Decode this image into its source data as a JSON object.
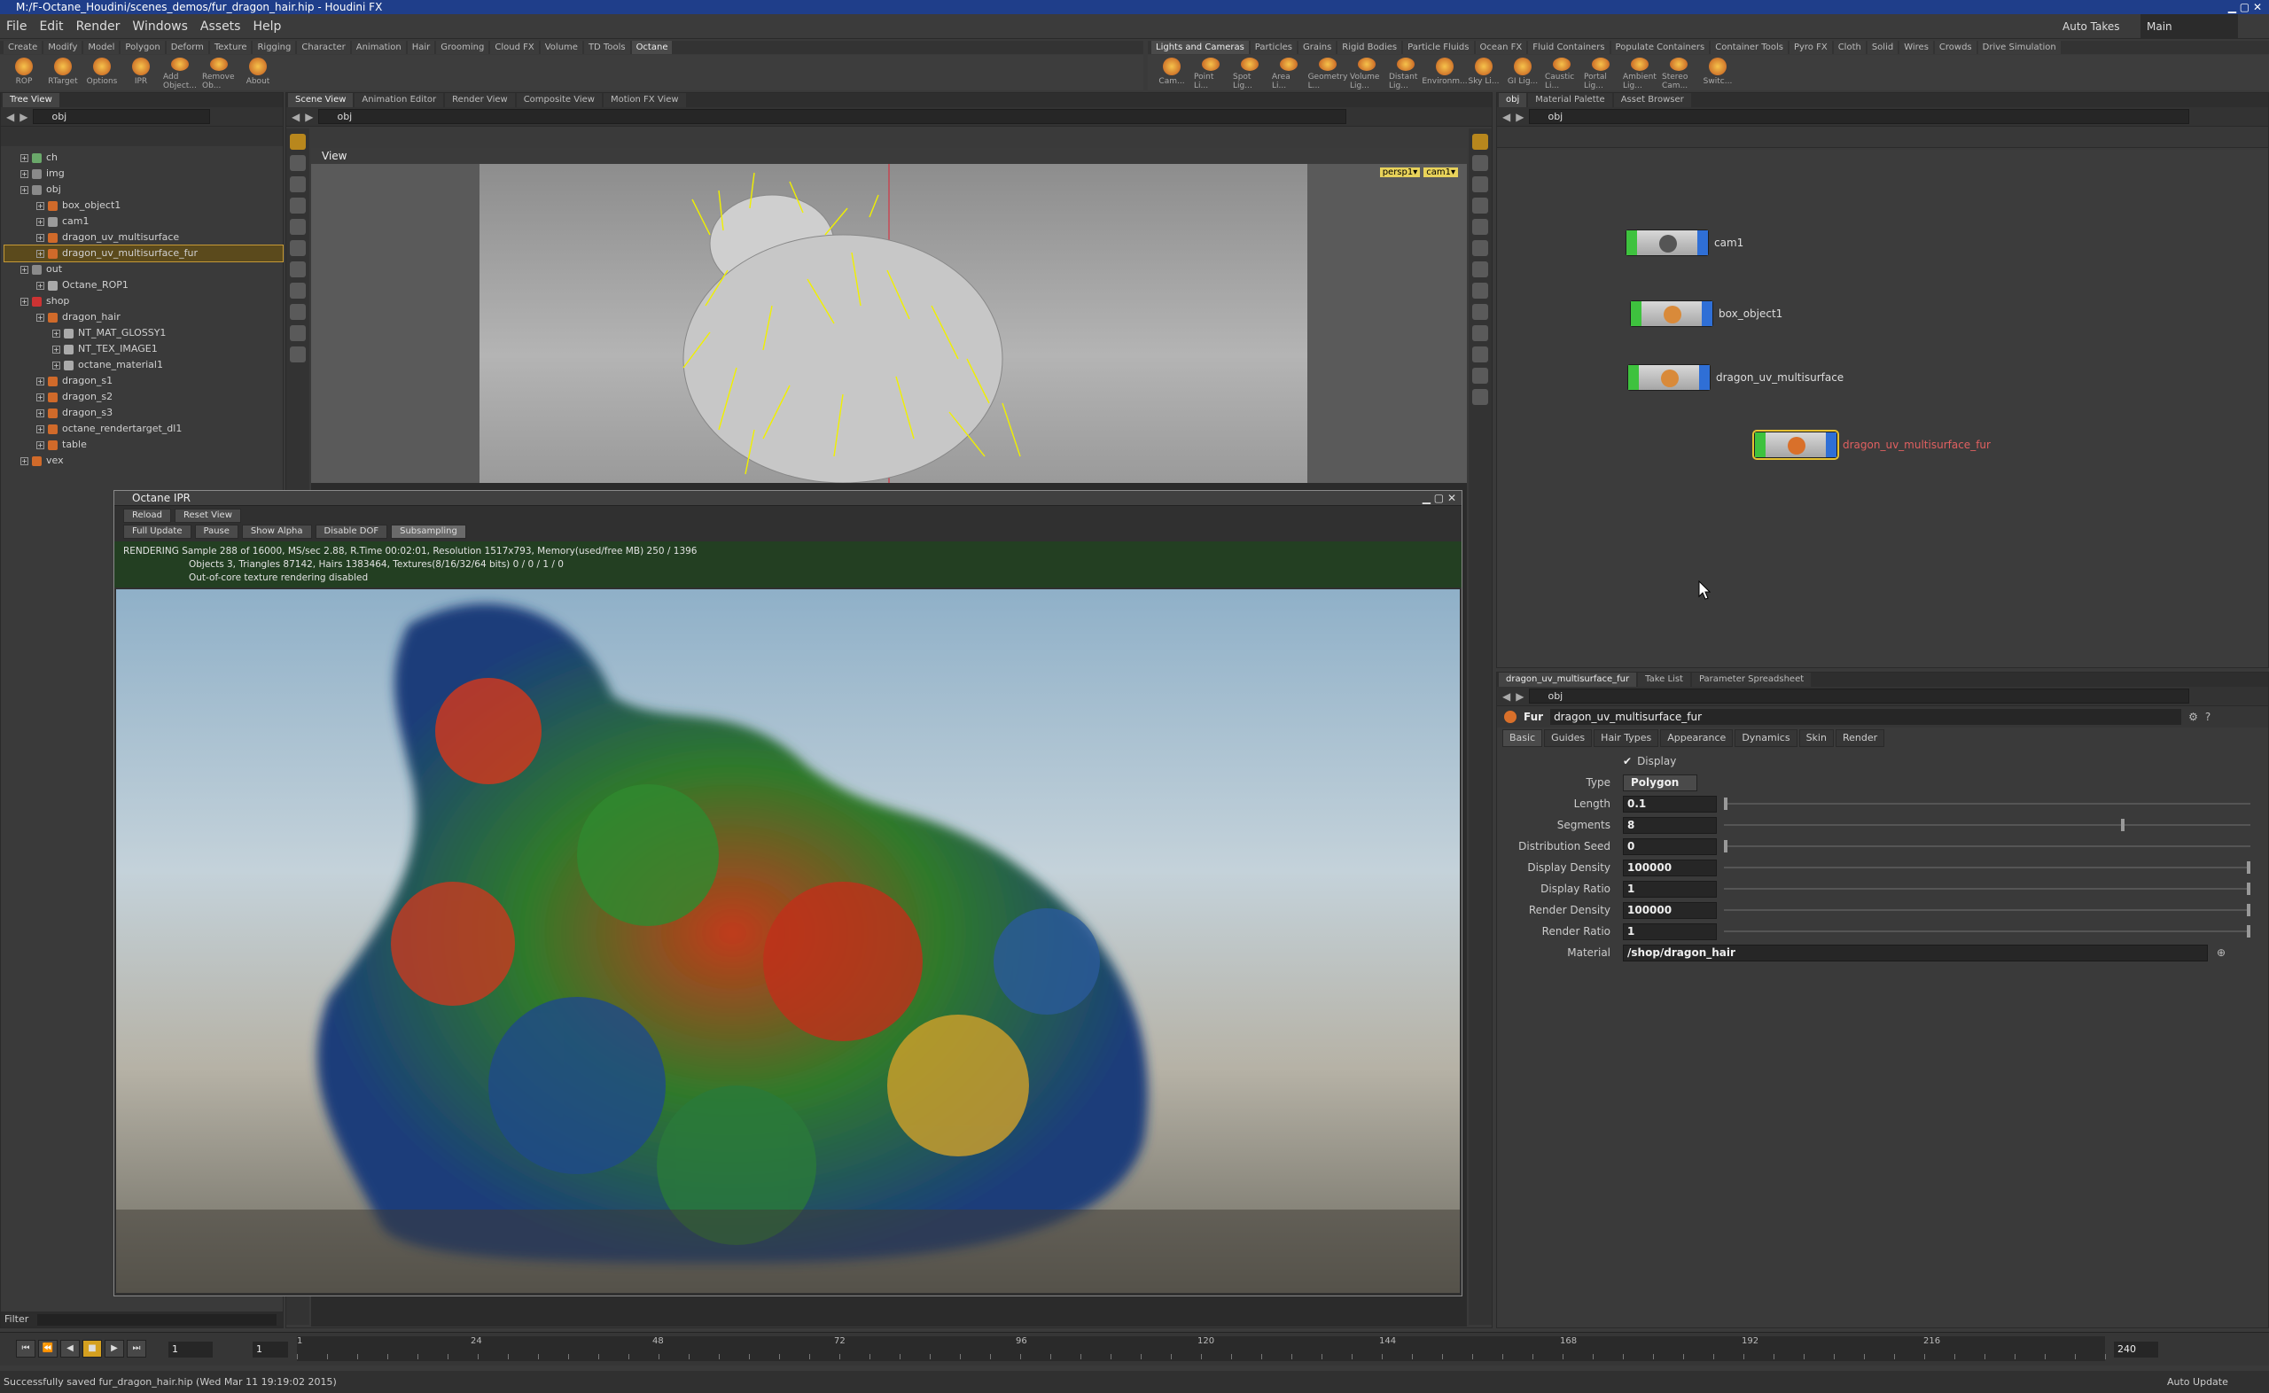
{
  "window": {
    "title": "M:/F-Octane_Houdini/scenes_demos/fur_dragon_hair.hip - Houdini FX"
  },
  "menu": [
    "File",
    "Edit",
    "Render",
    "Windows",
    "Assets",
    "Help"
  ],
  "menu_right": {
    "auto_takes": "Auto Takes",
    "desktop": "Main"
  },
  "shelf_tabs_left": [
    "Create",
    "Modify",
    "Model",
    "Polygon",
    "Deform",
    "Texture",
    "Rigging",
    "Character",
    "Animation",
    "Hair",
    "Grooming",
    "Cloud FX",
    "Volume",
    "TD Tools",
    "Octane"
  ],
  "shelf_tools_left": [
    "ROP",
    "RTarget",
    "Options",
    "IPR",
    "Add Object...",
    "Remove Ob...",
    "About"
  ],
  "shelf_tabs_right": [
    "Lights and Cameras",
    "Particles",
    "Grains",
    "Rigid Bodies",
    "Particle Fluids",
    "Ocean FX",
    "Fluid Containers",
    "Populate Containers",
    "Container Tools",
    "Pyro FX",
    "Cloth",
    "Solid",
    "Wires",
    "Crowds",
    "Drive Simulation"
  ],
  "shelf_tools_right": [
    "Cam...",
    "Point Li...",
    "Spot Lig...",
    "Area Li...",
    "Geometry L...",
    "Volume Lig...",
    "Distant Lig...",
    "Environm...",
    "Sky Li...",
    "GI Lig...",
    "Caustic Li...",
    "Portal Lig...",
    "Ambient Lig...",
    "Stereo Cam...",
    "Switc..."
  ],
  "tree": {
    "tab": "Tree View",
    "path": "obj",
    "filter_label": "Filter",
    "rows": [
      {
        "label": "ch",
        "depth": 1,
        "color": "#6aa86a"
      },
      {
        "label": "img",
        "depth": 1,
        "color": "#8a8a8a"
      },
      {
        "label": "obj",
        "depth": 1,
        "color": "#8a8a8a"
      },
      {
        "label": "box_object1",
        "depth": 2,
        "color": "#d06a2a"
      },
      {
        "label": "cam1",
        "depth": 2,
        "color": "#9a9a9a"
      },
      {
        "label": "dragon_uv_multisurface",
        "depth": 2,
        "color": "#d06a2a"
      },
      {
        "label": "dragon_uv_multisurface_fur",
        "depth": 2,
        "color": "#d06a2a",
        "selected": true
      },
      {
        "label": "out",
        "depth": 1,
        "color": "#8a8a8a"
      },
      {
        "label": "Octane_ROP1",
        "depth": 2,
        "color": "#aaaaaa"
      },
      {
        "label": "shop",
        "depth": 1,
        "color": "#cc3333"
      },
      {
        "label": "dragon_hair",
        "depth": 2,
        "color": "#d06a2a"
      },
      {
        "label": "NT_MAT_GLOSSY1",
        "depth": 3,
        "color": "#aaaaaa"
      },
      {
        "label": "NT_TEX_IMAGE1",
        "depth": 3,
        "color": "#aaaaaa"
      },
      {
        "label": "octane_material1",
        "depth": 3,
        "color": "#aaaaaa"
      },
      {
        "label": "dragon_s1",
        "depth": 2,
        "color": "#d06a2a"
      },
      {
        "label": "dragon_s2",
        "depth": 2,
        "color": "#d06a2a"
      },
      {
        "label": "dragon_s3",
        "depth": 2,
        "color": "#d06a2a"
      },
      {
        "label": "octane_rendertarget_dl1",
        "depth": 2,
        "color": "#d06a2a"
      },
      {
        "label": "table",
        "depth": 2,
        "color": "#d06a2a"
      },
      {
        "label": "vex",
        "depth": 1,
        "color": "#d06a2a"
      }
    ]
  },
  "viewer": {
    "tabs": [
      "Scene View",
      "Animation Editor",
      "Render View",
      "Composite View",
      "Motion FX View"
    ],
    "path": "obj",
    "label": "View",
    "cam_badges": [
      "persp1▾",
      "cam1▾"
    ]
  },
  "ipr": {
    "title": "Octane IPR",
    "buttons_row1": [
      "Reload",
      "Reset View"
    ],
    "buttons_row2": [
      "Full Update",
      "Pause",
      "Show Alpha",
      "Disable DOF",
      "Subsampling"
    ],
    "status": [
      "RENDERING Sample 288 of 16000,  MS/sec 2.88,  R.Time 00:02:01,  Resolution 1517x793,  Memory(used/free MB) 250 / 1396",
      "Objects 3,  Triangles 87142,  Hairs 1383464,  Textures(8/16/32/64 bits) 0 / 0 / 1 / 0",
      "Out-of-core texture rendering disabled"
    ]
  },
  "network": {
    "tabs": [
      "obj",
      "Material Palette",
      "Asset Browser"
    ],
    "path": "obj",
    "nodes": [
      {
        "label": "cam1",
        "selected": false
      },
      {
        "label": "box_object1",
        "selected": false
      },
      {
        "label": "dragon_uv_multisurface",
        "selected": false
      },
      {
        "label": "dragon_uv_multisurface_fur",
        "selected": true
      }
    ]
  },
  "params": {
    "tabs": [
      "dragon_uv_multisurface_fur",
      "Take List",
      "Parameter Spreadsheet"
    ],
    "path": "obj",
    "node_type": "Fur",
    "node_name": "dragon_uv_multisurface_fur",
    "subtabs": [
      "Basic",
      "Guides",
      "Hair Types",
      "Appearance",
      "Dynamics",
      "Skin",
      "Render"
    ],
    "display_label": "Display",
    "type_label": "Type",
    "type_value": "Polygon",
    "rows": [
      {
        "label": "Length",
        "value": "0.1",
        "level": 0.0
      },
      {
        "label": "Segments",
        "value": "8",
        "level": 0.76
      },
      {
        "label": "Distribution Seed",
        "value": "0",
        "level": 0.0
      },
      {
        "label": "Display Density",
        "value": "100000",
        "level": 1.0
      },
      {
        "label": "Display Ratio",
        "value": "1",
        "level": 1.0
      },
      {
        "label": "Render Density",
        "value": "100000",
        "level": 1.0
      },
      {
        "label": "Render Ratio",
        "value": "1",
        "level": 1.0
      }
    ],
    "material_label": "Material",
    "material_value": "/shop/dragon_hair"
  },
  "timeline": {
    "current_frame": "1",
    "start_frame": "1",
    "end_frame": "240",
    "ticks": [
      "1",
      "24",
      "48",
      "72",
      "96",
      "120",
      "144",
      "168",
      "192",
      "216"
    ]
  },
  "status": {
    "message": "Successfully saved fur_dragon_hair.hip (Wed Mar 11 19:19:02 2015)",
    "auto_update": "Auto Update"
  }
}
